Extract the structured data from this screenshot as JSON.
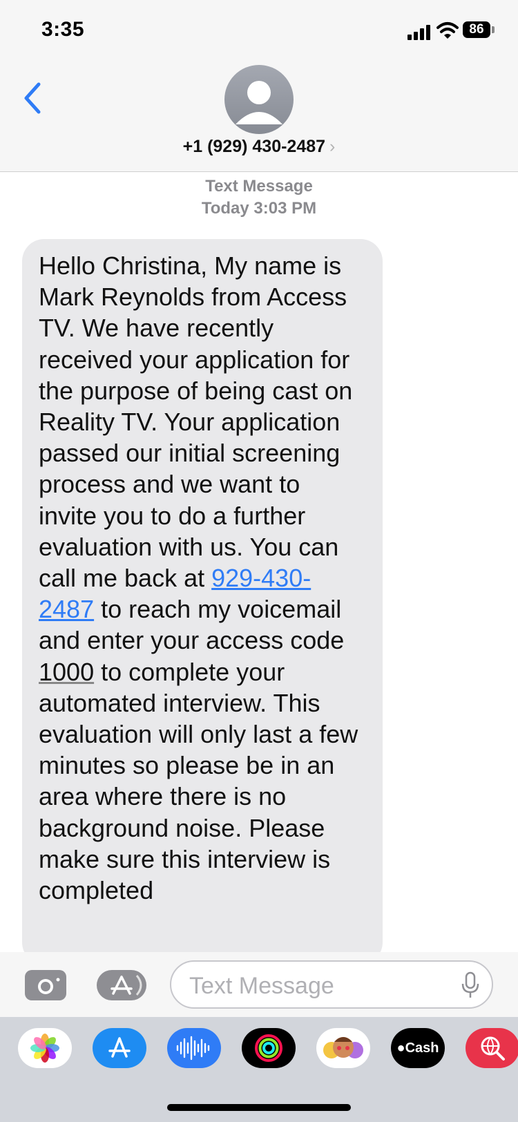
{
  "status_bar": {
    "time": "3:35",
    "battery": "86"
  },
  "header": {
    "contact": "+1 (929) 430-2487",
    "chevron": "›"
  },
  "thread": {
    "channel_label": "Text Message",
    "timestamp": "Today 3:03 PM",
    "message": {
      "part1": "Hello Christina, My name is Mark Reynolds from Access TV. We have recently received your application for the purpose of being cast on Reality TV.  Your application passed our initial screening process and we want to invite you to do a further evaluation with us. You can call me back at ",
      "phone_link": "929-430-2487",
      "part2": " to reach my voicemail and enter your access code ",
      "access_code": "1000",
      "part3": " to complete your automated interview.  This evaluation will only last a few minutes so please be in an area where there is no background noise. Please make sure this interview is completed"
    }
  },
  "composer": {
    "placeholder": "Text Message"
  },
  "app_drawer": {
    "apps": [
      {
        "name": "photos-app",
        "icon": "photos-icon"
      },
      {
        "name": "app-store-app",
        "icon": "app-store-icon"
      },
      {
        "name": "audio-message-app",
        "icon": "waveform-icon"
      },
      {
        "name": "fitness-app",
        "icon": "activity-rings-icon"
      },
      {
        "name": "memoji-app",
        "icon": "memoji-icon"
      },
      {
        "name": "apple-cash-app",
        "icon": "apple-cash-icon",
        "label": "Cash"
      },
      {
        "name": "web-search-app",
        "icon": "globe-search-icon"
      }
    ]
  },
  "colors": {
    "link": "#2f7cf6",
    "bubble": "#e9e9eb",
    "ios_blue": "#2f7cf6"
  }
}
